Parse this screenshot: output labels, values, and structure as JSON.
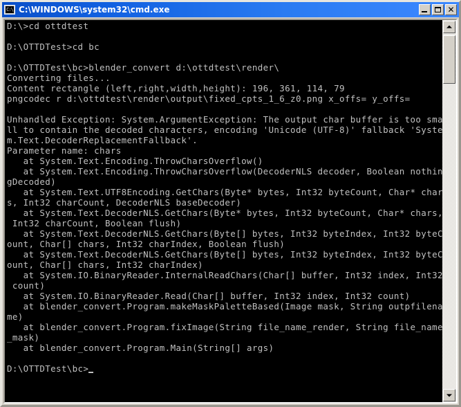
{
  "window": {
    "title": "C:\\WINDOWS\\system32\\cmd.exe",
    "icon_glyph": "C:\\",
    "icon_name": "cmd-console-icon",
    "minimize_label": "",
    "maximize_label": "",
    "close_label": "✕",
    "titlebar_color": "#1160e0",
    "face_color": "#d4d0c8"
  },
  "console": {
    "background_color": "#000000",
    "text_color": "#c0c0c0",
    "columns": 80,
    "prompt": "D:\\OTTDTest\\bc>",
    "cursor": "_",
    "lines": [
      "D:\\>cd ottdtest",
      "",
      "D:\\OTTDTest>cd bc",
      "",
      "D:\\OTTDTest\\bc>blender_convert d:\\ottdtest\\render\\",
      "Converting files...",
      "Content rectangle (left,right,width,height): 196, 361, 114, 79",
      "pngcodec r d:\\ottdtest\\render\\output\\fixed_cpts_1_6_z0.png x_offs= y_offs=",
      "",
      "Unhandled Exception: System.ArgumentException: The output char buffer is too sma",
      "ll to contain the decoded characters, encoding 'Unicode (UTF-8)' fallback 'Syste",
      "m.Text.DecoderReplacementFallback'.",
      "Parameter name: chars",
      "   at System.Text.Encoding.ThrowCharsOverflow()",
      "   at System.Text.Encoding.ThrowCharsOverflow(DecoderNLS decoder, Boolean nothin",
      "gDecoded)",
      "   at System.Text.UTF8Encoding.GetChars(Byte* bytes, Int32 byteCount, Char* char",
      "s, Int32 charCount, DecoderNLS baseDecoder)",
      "   at System.Text.DecoderNLS.GetChars(Byte* bytes, Int32 byteCount, Char* chars,",
      " Int32 charCount, Boolean flush)",
      "   at System.Text.DecoderNLS.GetChars(Byte[] bytes, Int32 byteIndex, Int32 byteC",
      "ount, Char[] chars, Int32 charIndex, Boolean flush)",
      "   at System.Text.DecoderNLS.GetChars(Byte[] bytes, Int32 byteIndex, Int32 byteC",
      "ount, Char[] chars, Int32 charIndex)",
      "   at System.IO.BinaryReader.InternalReadChars(Char[] buffer, Int32 index, Int32",
      " count)",
      "   at System.IO.BinaryReader.Read(Char[] buffer, Int32 index, Int32 count)",
      "   at blender_convert.Program.makeMaskPaletteBased(Image mask, String outpfilena",
      "me)",
      "   at blender_convert.Program.fixImage(String file_name_render, String file_name",
      "_mask)",
      "   at blender_convert.Program.Main(String[] args)",
      "",
      "D:\\OTTDTest\\bc>"
    ]
  },
  "scrollbar": {
    "up_arrow": "▲",
    "down_arrow": "▼"
  }
}
